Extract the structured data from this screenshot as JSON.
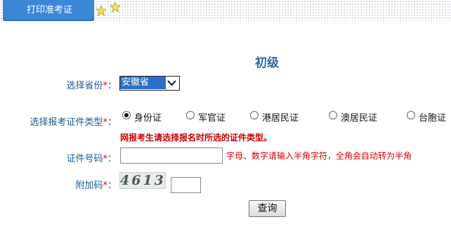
{
  "tab": {
    "label": "打印准考证"
  },
  "title": "初级",
  "province": {
    "label": "选择省份",
    "value": "安徽省"
  },
  "cert_type": {
    "label": "选择报考证件类型",
    "options": [
      {
        "label": "身份证",
        "selected": true
      },
      {
        "label": "军官证",
        "selected": false
      },
      {
        "label": "港居民证",
        "selected": false
      },
      {
        "label": "澳居民证",
        "selected": false
      },
      {
        "label": "台胞证",
        "selected": false
      }
    ],
    "hint": "网报考生请选择报名时所选的证件类型。"
  },
  "cert_number": {
    "label": "证件号码",
    "value": "",
    "tip": "字母、数字请输入半角字符，全角会自动转为半角"
  },
  "captcha": {
    "label": "附加码",
    "image_text": "4613",
    "value": ""
  },
  "required_mark": "*",
  "colon": "：",
  "submit": {
    "label": "查询"
  }
}
